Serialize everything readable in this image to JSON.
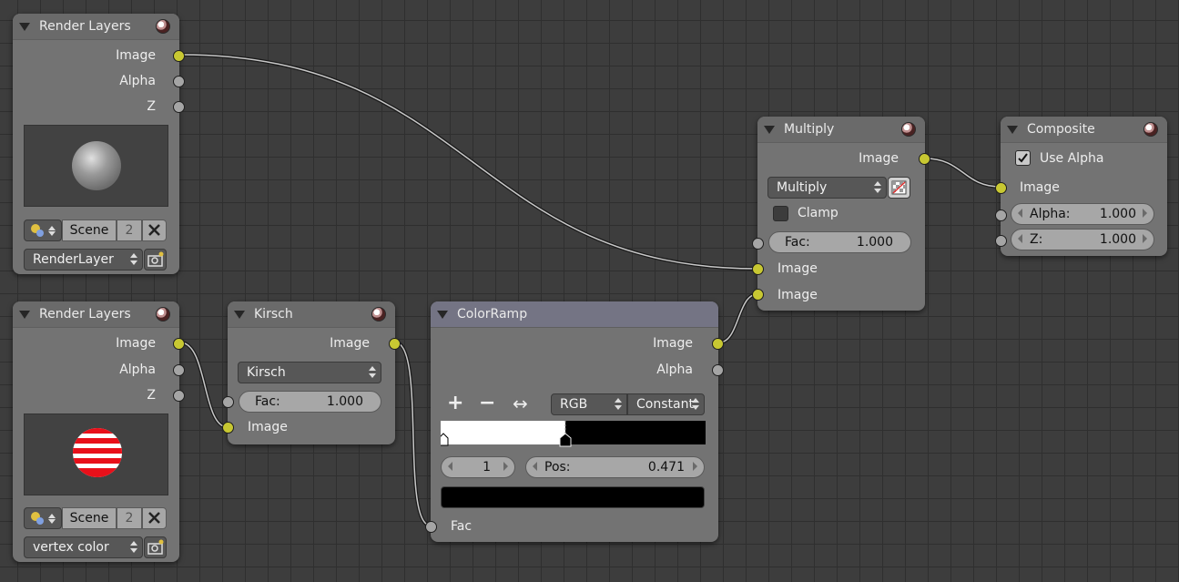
{
  "nodes": {
    "render_layers_1": {
      "title": "Render Layers",
      "outputs": [
        "Image",
        "Alpha",
        "Z"
      ],
      "scene_label": "Scene",
      "scene_users": "2",
      "layer": "RenderLayer"
    },
    "render_layers_2": {
      "title": "Render Layers",
      "outputs": [
        "Image",
        "Alpha",
        "Z"
      ],
      "scene_label": "Scene",
      "scene_users": "2",
      "layer": "vertex color"
    },
    "kirsch": {
      "title": "Kirsch",
      "output": "Image",
      "filter_type": "Kirsch",
      "fac_label": "Fac:",
      "fac_value": "1.000",
      "input": "Image"
    },
    "colorramp": {
      "title": "ColorRamp",
      "outputs": [
        "Image",
        "Alpha"
      ],
      "add_symbol": "+",
      "remove_symbol": "−",
      "flip_symbol": "↔",
      "color_mode": "RGB",
      "interpolation": "Constant",
      "active_index": "1",
      "pos_label": "Pos:",
      "pos_value": "0.471",
      "input": "Fac",
      "selected_color": "#000000"
    },
    "multiply": {
      "title": "Multiply",
      "output": "Image",
      "blend_mode": "Multiply",
      "clamp_label": "Clamp",
      "clamp_checked": false,
      "fac_label": "Fac:",
      "fac_value": "1.000",
      "inputs": [
        "Image",
        "Image"
      ]
    },
    "composite": {
      "title": "Composite",
      "use_alpha_label": "Use Alpha",
      "use_alpha_checked": true,
      "input": "Image",
      "alpha_label": "Alpha:",
      "alpha_value": "1.000",
      "z_label": "Z:",
      "z_value": "1.000"
    }
  },
  "colors": {
    "image_socket": "#c8c832",
    "value_socket": "#a5a5a5",
    "node_body": "#737373",
    "grid_bg": "#3d3d3d"
  }
}
